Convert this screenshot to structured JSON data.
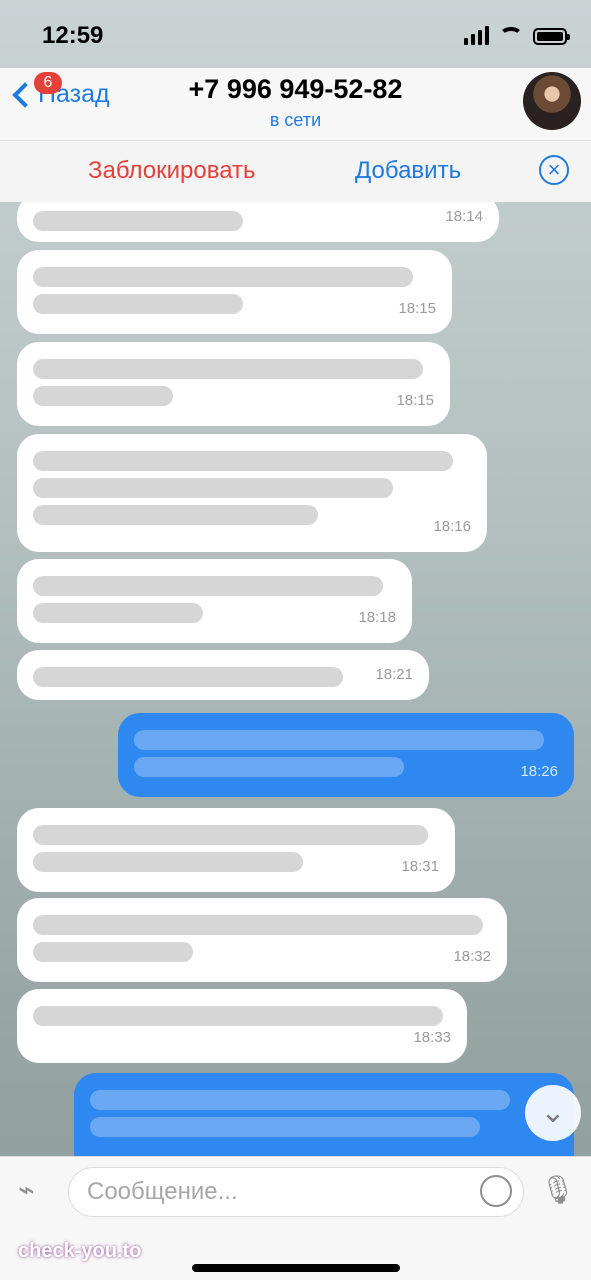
{
  "status_bar": {
    "time": "12:59"
  },
  "header": {
    "back_label": "Назад",
    "unread_badge": "6",
    "title": "+7 996 949-52-82",
    "subtitle": "в сети"
  },
  "action_bar": {
    "block_label": "Заблокировать",
    "add_label": "Добавить"
  },
  "messages": [
    {
      "time": "18:14"
    },
    {
      "time": "18:15"
    },
    {
      "time": "18:15"
    },
    {
      "time": "18:16"
    },
    {
      "time": "18:18"
    },
    {
      "time": "18:21"
    },
    {
      "time": "18:26"
    },
    {
      "time": "18:31"
    },
    {
      "time": "18:32"
    },
    {
      "time": "18:33"
    }
  ],
  "composer": {
    "placeholder": "Сообщение..."
  },
  "watermark": "check-you.to",
  "colors": {
    "accent": "#1f7ae0",
    "danger": "#e5403a",
    "outgoing_bubble": "#2f88f0"
  }
}
